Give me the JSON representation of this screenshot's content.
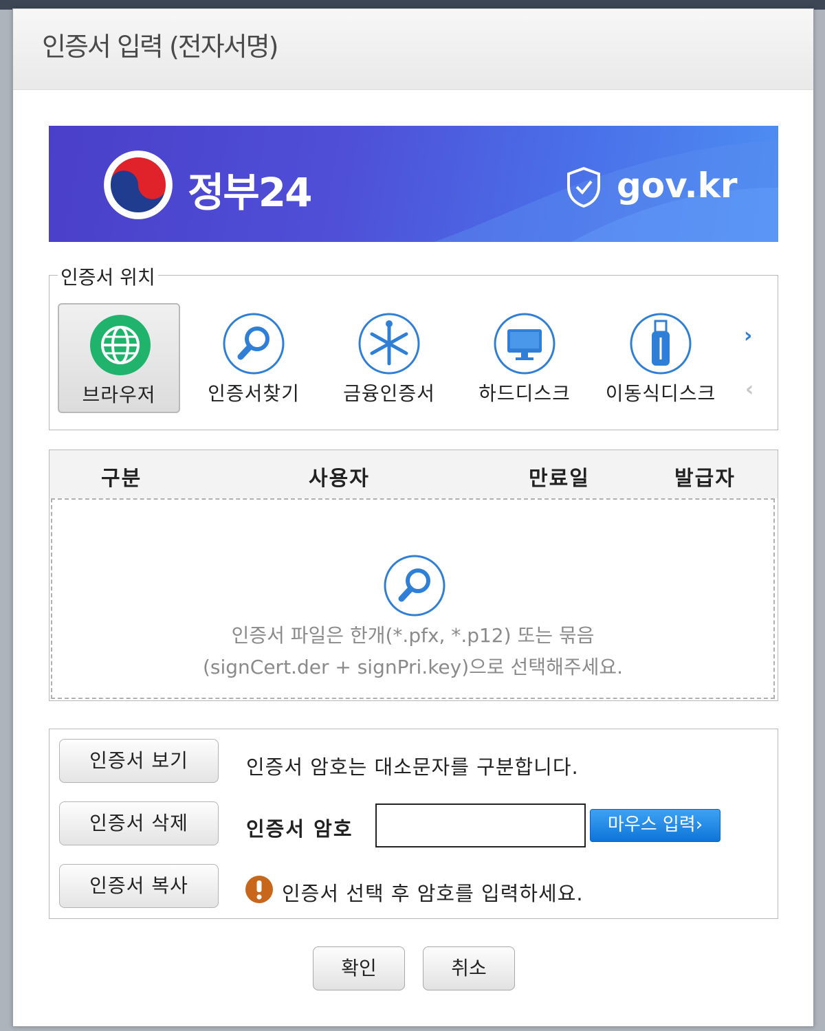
{
  "dialog": {
    "title": "인증서 입력 (전자서명)"
  },
  "banner": {
    "service_name": "정부24",
    "domain": "gov.kr"
  },
  "location": {
    "legend": "인증서 위치",
    "items": [
      {
        "label": "브라우저",
        "icon": "globe-icon",
        "selected": true
      },
      {
        "label": "인증서찾기",
        "icon": "search-icon"
      },
      {
        "label": "금융인증서",
        "icon": "financial-cert-icon"
      },
      {
        "label": "하드디스크",
        "icon": "monitor-icon"
      },
      {
        "label": "이동식디스크",
        "icon": "usb-icon"
      }
    ],
    "next_icon": "›",
    "prev_icon": "‹"
  },
  "cert_table": {
    "columns": [
      "구분",
      "사용자",
      "만료일",
      "발급자"
    ],
    "empty_line1": "인증서 파일은 한개(*.pfx, *.p12) 또는 묶음",
    "empty_line2": "(signCert.der + signPri.key)으로 선택해주세요."
  },
  "actions": {
    "view_label": "인증서 보기",
    "delete_label": "인증서 삭제",
    "copy_label": "인증서 복사",
    "case_notice": "인증서 암호는 대소문자를 구분합니다.",
    "password_label": "인증서 암호",
    "password_value": "",
    "mouse_input_label": "마우스 입력›",
    "warning": "인증서 선택 후 암호를 입력하세요."
  },
  "footer": {
    "confirm_label": "확인",
    "cancel_label": "취소"
  },
  "colors": {
    "accent": "#0e75d8",
    "selected_green": "#1fb36b",
    "icon_blue": "#2f7fd6",
    "warning": "#c8661c"
  }
}
